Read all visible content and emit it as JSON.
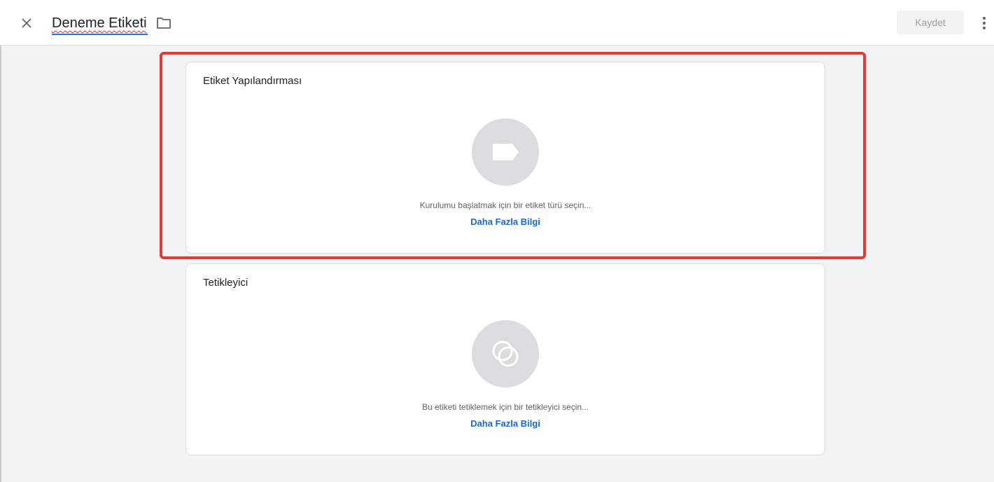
{
  "header": {
    "title": "Deneme Etiketi",
    "save_label": "Kaydet",
    "close_icon": "close-icon",
    "folder_icon": "folder-icon",
    "more_icon": "more-vert-icon"
  },
  "cards": {
    "tag": {
      "title": "Etiket Yapılandırması",
      "hint": "Kurulumu başlatmak için bir etiket türü seçin...",
      "link": "Daha Fazla Bilgi",
      "icon": "tag-icon"
    },
    "trigger": {
      "title": "Tetikleyici",
      "hint": "Bu etiketi tetiklemek için bir tetikleyici seçin...",
      "link": "Daha Fazla Bilgi",
      "icon": "trigger-icon"
    }
  },
  "colors": {
    "accent_link": "#1967d2",
    "highlight": "#e53935",
    "icon_circle": "#dadce0"
  }
}
